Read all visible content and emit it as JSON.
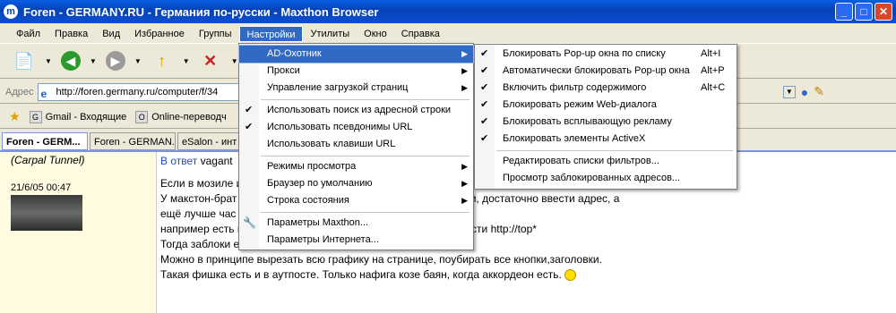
{
  "window": {
    "title": "Foren - GERMANY.RU - Германия по-русски - Maxthon Browser",
    "logo": "m",
    "minimize": "_",
    "maximize": "□",
    "close": "✕"
  },
  "menu": {
    "items": [
      "Файл",
      "Правка",
      "Вид",
      "Избранное",
      "Группы",
      "Настройки",
      "Утилиты",
      "Окно",
      "Справка"
    ]
  },
  "toolbar": {
    "new": "📄",
    "back": "◀",
    "forward": "▶",
    "up": "↑",
    "stop": "✕",
    "globe": "●",
    "brush": "✎",
    "dropdown": "▼"
  },
  "address": {
    "label": "Адрес",
    "url": "http://foren.germany.ru/computer/f/34",
    "icon": "e"
  },
  "favorites": {
    "star": "★",
    "items": [
      {
        "icon": "G",
        "label": "Gmail - Входящие"
      },
      {
        "icon": "O",
        "label": "Online-переводч"
      }
    ]
  },
  "tabs": [
    "Foren - GERM...",
    "Foren - GERMAN...",
    "eSalon - инт"
  ],
  "post": {
    "rank": "(Carpal Tunnel)",
    "date": "21/6/05 00:47",
    "reply_link": "В ответ",
    "reply_user": "vagant",
    "lines": [
      "Если в мозиле                                                      ие, то это одно уродство.",
      "У макстон-брат                                                 бы как с попапами так и с другими элементами, достаточно ввести адрес, а",
      "ещё лучше час",
      "например есть                                               можно заблокировать весь адрес, а лучше ввести http://top*",
      "Тогда заблоки                                         емых страницах.",
      "Можно в принципе вырезать всю графику на странице, поубирать все кнопки,заголовки.",
      "Такая фишка есть и в аутпосте. Только нафига козе баян, когда аккордеон есть."
    ]
  },
  "settings_menu": {
    "items": [
      {
        "label": "AD-Охотник",
        "checked": false,
        "submenu": true,
        "highlighted": true
      },
      {
        "label": "Прокси",
        "checked": false,
        "submenu": true
      },
      {
        "label": "Управление загрузкой страниц",
        "checked": false,
        "submenu": true
      },
      {
        "label": "Использовать поиск из адресной строки",
        "checked": true,
        "submenu": false
      },
      {
        "label": "Использовать псевдонимы URL",
        "checked": true,
        "submenu": false
      },
      {
        "label": "Использовать клавиши URL",
        "checked": false,
        "submenu": false
      },
      {
        "label": "Режимы просмотра",
        "checked": false,
        "submenu": true
      },
      {
        "label": "Браузер по умолчанию",
        "checked": false,
        "submenu": true
      },
      {
        "label": "Строка состояния",
        "checked": false,
        "submenu": true
      },
      {
        "label": "Параметры Maxthon...",
        "icon": "wrench",
        "submenu": false
      },
      {
        "label": "Параметры Интернета...",
        "checked": false,
        "submenu": false
      }
    ],
    "check_glyph": "✔",
    "arrow_glyph": "▶",
    "wrench_glyph": "🔧"
  },
  "ad_hunter_menu": {
    "items": [
      {
        "label": "Блокировать Pop-up окна по списку",
        "shortcut": "Alt+I",
        "checked": true
      },
      {
        "label": "Автоматически блокировать Pop-up окна",
        "shortcut": "Alt+P",
        "checked": true
      },
      {
        "label": "Включить фильтр содержимого",
        "shortcut": "Alt+C",
        "checked": true
      },
      {
        "label": "Блокировать режим Web-диалога",
        "shortcut": "",
        "checked": true
      },
      {
        "label": "Блокировать всплывающую рекламу",
        "shortcut": "",
        "checked": true
      },
      {
        "label": "Блокировать элементы ActiveX",
        "shortcut": "",
        "checked": true
      },
      {
        "label": "Редактировать списки фильтров...",
        "shortcut": "",
        "checked": false
      },
      {
        "label": "Просмотр заблокированных адресов...",
        "shortcut": "",
        "checked": false
      }
    ]
  }
}
